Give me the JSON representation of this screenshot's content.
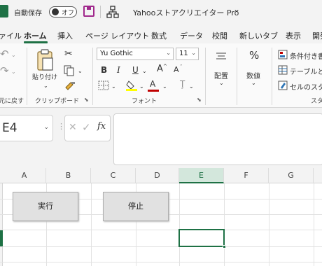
{
  "titlebar": {
    "autosave_label": "自動保存",
    "toggle_state": "オフ",
    "doc_title": "Yahooストアクリエイター Pro",
    "title_chevron": "⌄"
  },
  "tabs": [
    "ァイル",
    "ホーム",
    "挿入",
    "ページ レイアウト",
    "数式",
    "データ",
    "校閲",
    "新しいタブ",
    "表示",
    "開発"
  ],
  "active_tab": "ホーム",
  "ribbon": {
    "undo": {
      "label": "元に戻す"
    },
    "clipboard": {
      "paste_label": "貼り付け",
      "group_label": "クリップボード"
    },
    "font": {
      "family": "Yu Gothic",
      "size": "11",
      "bold": "B",
      "italic": "I",
      "underline": "U",
      "grow": "A",
      "shrink": "A",
      "group_label": "フォント"
    },
    "alignment": {
      "label": "配置"
    },
    "number": {
      "symbol": "%",
      "label": "数値"
    },
    "styles": {
      "conditional": "条件付き書",
      "table": "テーブルとし",
      "cell": "セルのスター",
      "group_label": "スタ"
    }
  },
  "formula_bar": {
    "name_box": "E4",
    "cancel": "✕",
    "enter": "✓",
    "fx": "fx",
    "formula": ""
  },
  "grid": {
    "columns": [
      "A",
      "B",
      "C",
      "D",
      "E",
      "F",
      "G"
    ],
    "selected_column": "E",
    "buttons": [
      {
        "label": "実行"
      },
      {
        "label": "停止"
      }
    ]
  },
  "colors": {
    "accent": "#1e7145",
    "save_icon": "#a0288c",
    "font_color": "#c00000",
    "highlight": "#ffff00"
  }
}
